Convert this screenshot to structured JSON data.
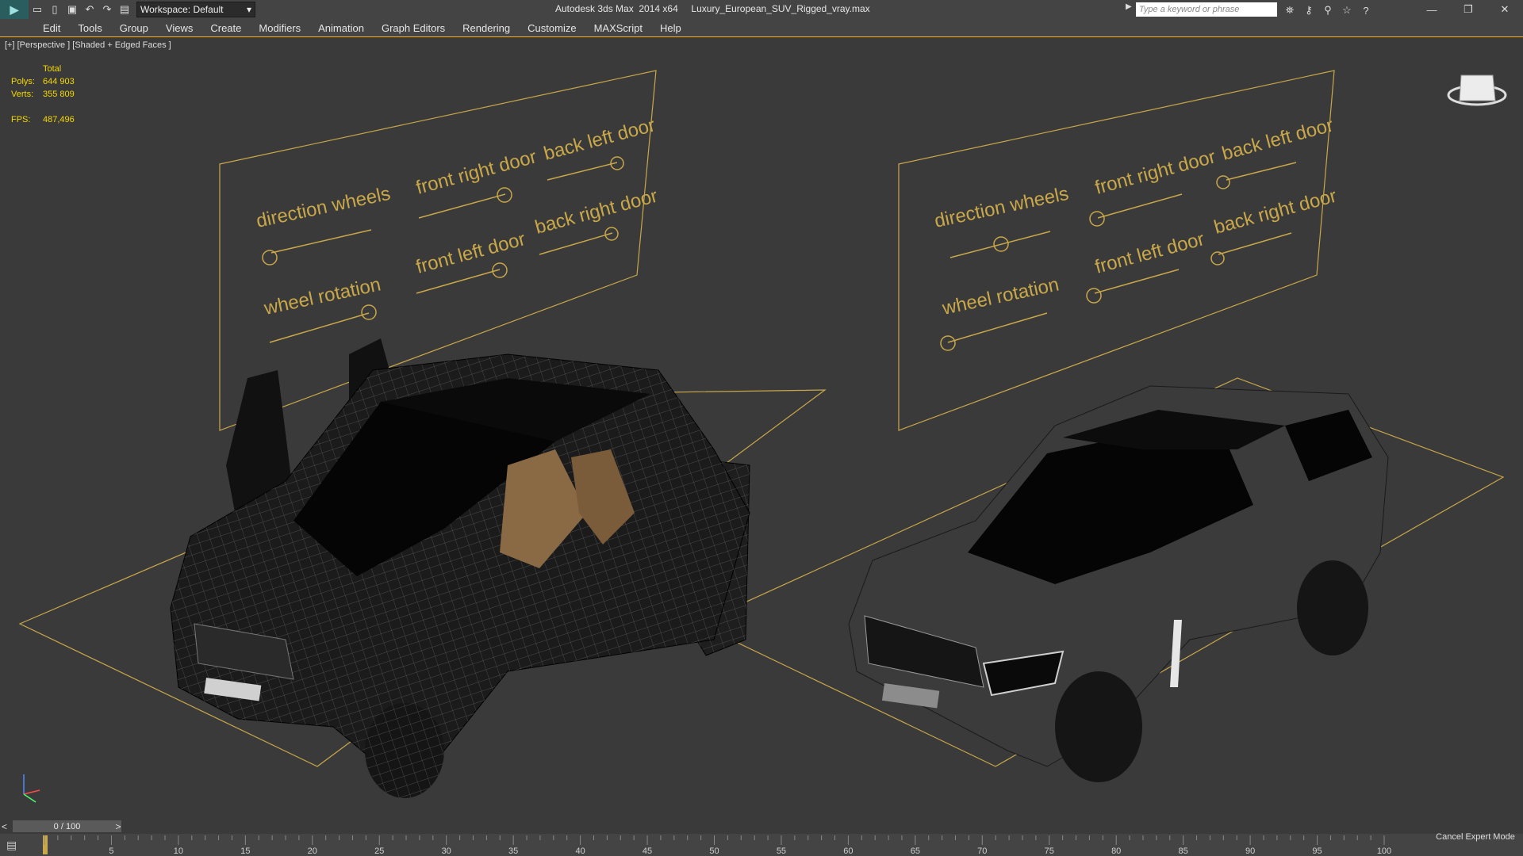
{
  "titlebar": {
    "workspace_label": "Workspace: Default",
    "app_title": "Autodesk 3ds Max  2014 x64     Luxury_European_SUV_Rigged_vray.max",
    "search_placeholder": "Type a keyword or phrase"
  },
  "menu": {
    "items": [
      "Edit",
      "Tools",
      "Group",
      "Views",
      "Create",
      "Modifiers",
      "Animation",
      "Graph Editors",
      "Rendering",
      "Customize",
      "MAXScript",
      "Help"
    ]
  },
  "viewport": {
    "label": "[+] [Perspective ] [Shaded + Edged Faces ]",
    "stats": {
      "header": "Total",
      "polys_label": "Polys:",
      "polys_value": "644 903",
      "verts_label": "Verts:",
      "verts_value": "355 809",
      "fps_label": "FPS:",
      "fps_value": "487,496"
    },
    "control_labels": {
      "direction_wheels": "direction wheels",
      "wheel_rotation": "wheel rotation",
      "front_right_door": "front right door",
      "front_left_door": "front left door",
      "back_left_door": "back left door",
      "back_right_door": "back right door"
    },
    "colors": {
      "rig_gold": "#c9a84a",
      "mesh_dark": "#1b1b1b",
      "shaded_body": "#3b3b3b"
    }
  },
  "timeline": {
    "frame_display": "0 / 100",
    "ticks": [
      "5",
      "10",
      "15",
      "20",
      "25",
      "30",
      "35",
      "40",
      "45",
      "50",
      "55",
      "60",
      "65",
      "70",
      "75",
      "80",
      "85",
      "90",
      "95",
      "100"
    ]
  },
  "status": {
    "cancel_expert": "Cancel Expert Mode"
  }
}
